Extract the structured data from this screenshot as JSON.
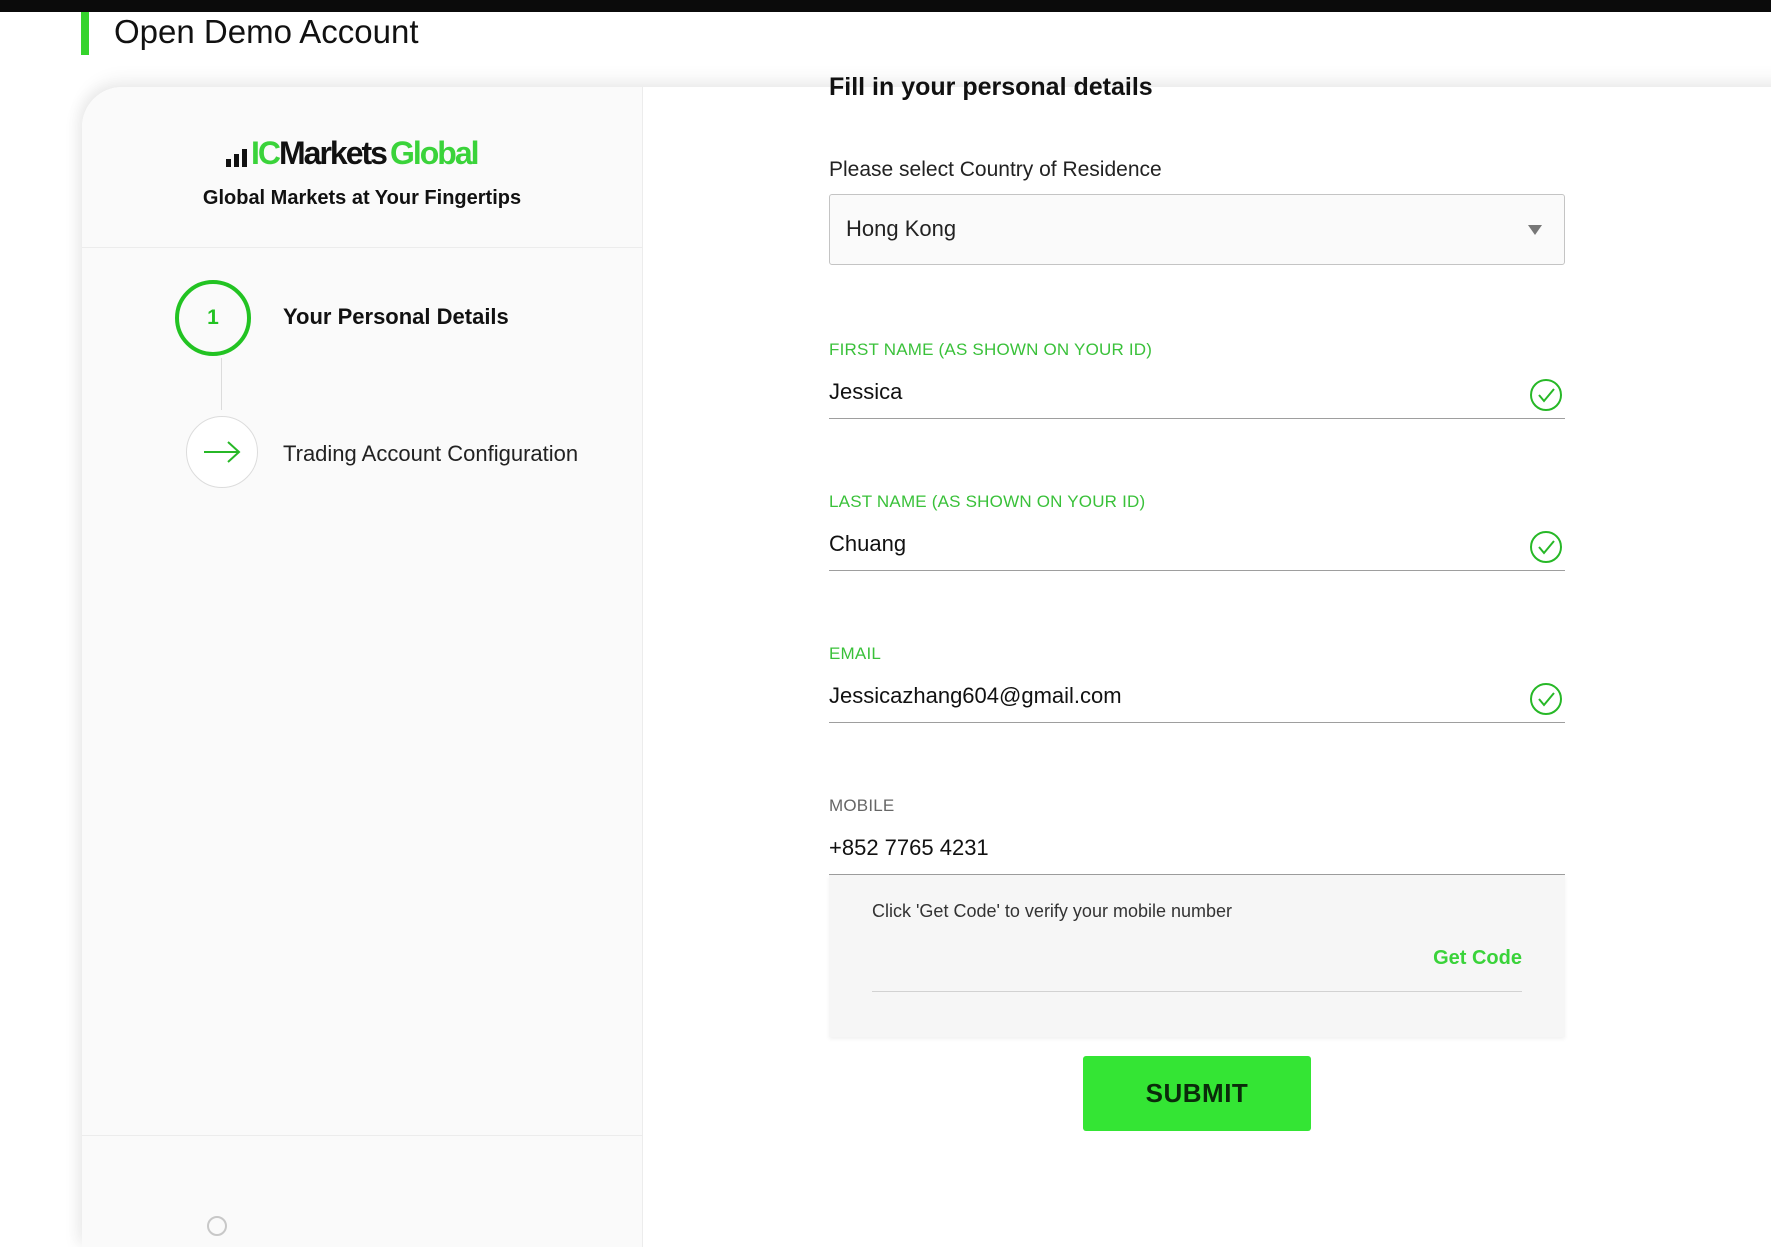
{
  "page": {
    "title": "Open Demo Account"
  },
  "brand": {
    "logo_ic": "IC",
    "logo_markets": "Markets",
    "logo_global": "Global",
    "tagline": "Global Markets at Your Fingertips",
    "accent_color": "#35d42c"
  },
  "steps": [
    {
      "number": "1",
      "label": "Your Personal Details",
      "state": "active"
    },
    {
      "label": "Trading Account Configuration",
      "state": "upcoming",
      "icon": "arrow-right-icon"
    }
  ],
  "form": {
    "heading": "Fill in your personal details",
    "country": {
      "label": "Please select Country of Residence",
      "value": "Hong Kong"
    },
    "first_name": {
      "label": "FIRST NAME (AS SHOWN ON YOUR ID)",
      "value": "Jessica",
      "valid": true
    },
    "last_name": {
      "label": "LAST NAME (AS SHOWN ON YOUR ID)",
      "value": "Chuang",
      "valid": true
    },
    "email": {
      "label": "EMAIL",
      "value": "Jessicazhang604@gmail.com",
      "valid": true
    },
    "mobile": {
      "label": "MOBILE",
      "value": "+852 7765 4231"
    },
    "verify": {
      "text": "Click 'Get Code' to verify your mobile number",
      "get_code_label": "Get Code"
    },
    "submit_label": "SUBMIT"
  }
}
